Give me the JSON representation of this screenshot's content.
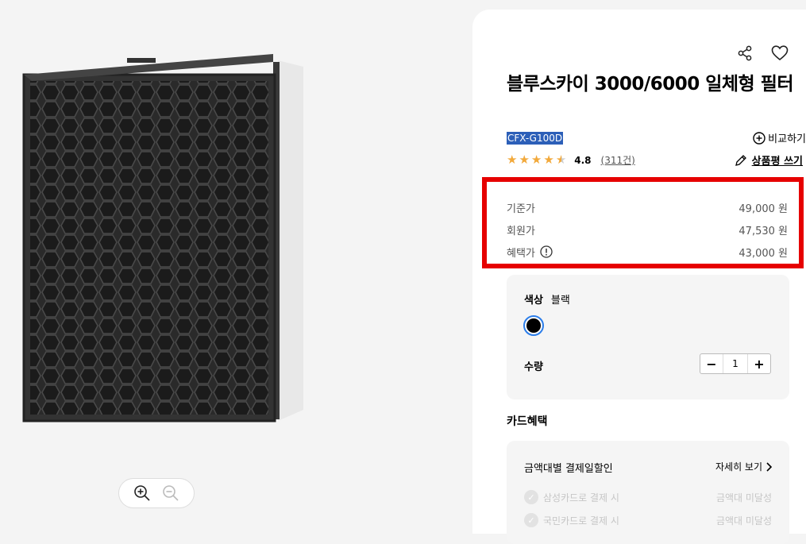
{
  "product": {
    "title": "블루스카이 3000/6000 일체형 필터",
    "model": "CFX-G100D",
    "rating": "4.8",
    "review_count": "(311건)",
    "stars": 4.5
  },
  "actions": {
    "compare": "비교하기",
    "write_review": "상품평 쓰기"
  },
  "prices": [
    {
      "label": "기준가",
      "value": "49,000 원"
    },
    {
      "label": "회원가",
      "value": "47,530 원"
    },
    {
      "label": "혜택가",
      "value": "43,000 원"
    }
  ],
  "options": {
    "color_label": "색상",
    "color_value": "블랙",
    "swatch_color": "#000000",
    "qty_label": "수량",
    "qty_value": "1",
    "minus": "−",
    "plus": "+"
  },
  "card": {
    "section_title": "카드혜택",
    "head": "금액대별 결제일할인",
    "more": "자세히 보기",
    "items": [
      {
        "name": "삼성카드로 결제 시",
        "status": "금액대 미달성"
      },
      {
        "name": "국민카드로 결제 시",
        "status": "금액대 미달성"
      }
    ]
  },
  "colors": {
    "highlight": "#e60000",
    "accent": "#2b7de9",
    "star": "#f2a93b"
  },
  "icons": [
    "share-icon",
    "heart-icon",
    "zoom-in-icon",
    "zoom-out-icon",
    "plus-circle-icon",
    "pencil-icon",
    "info-icon",
    "chevron-right-icon",
    "check-icon"
  ]
}
